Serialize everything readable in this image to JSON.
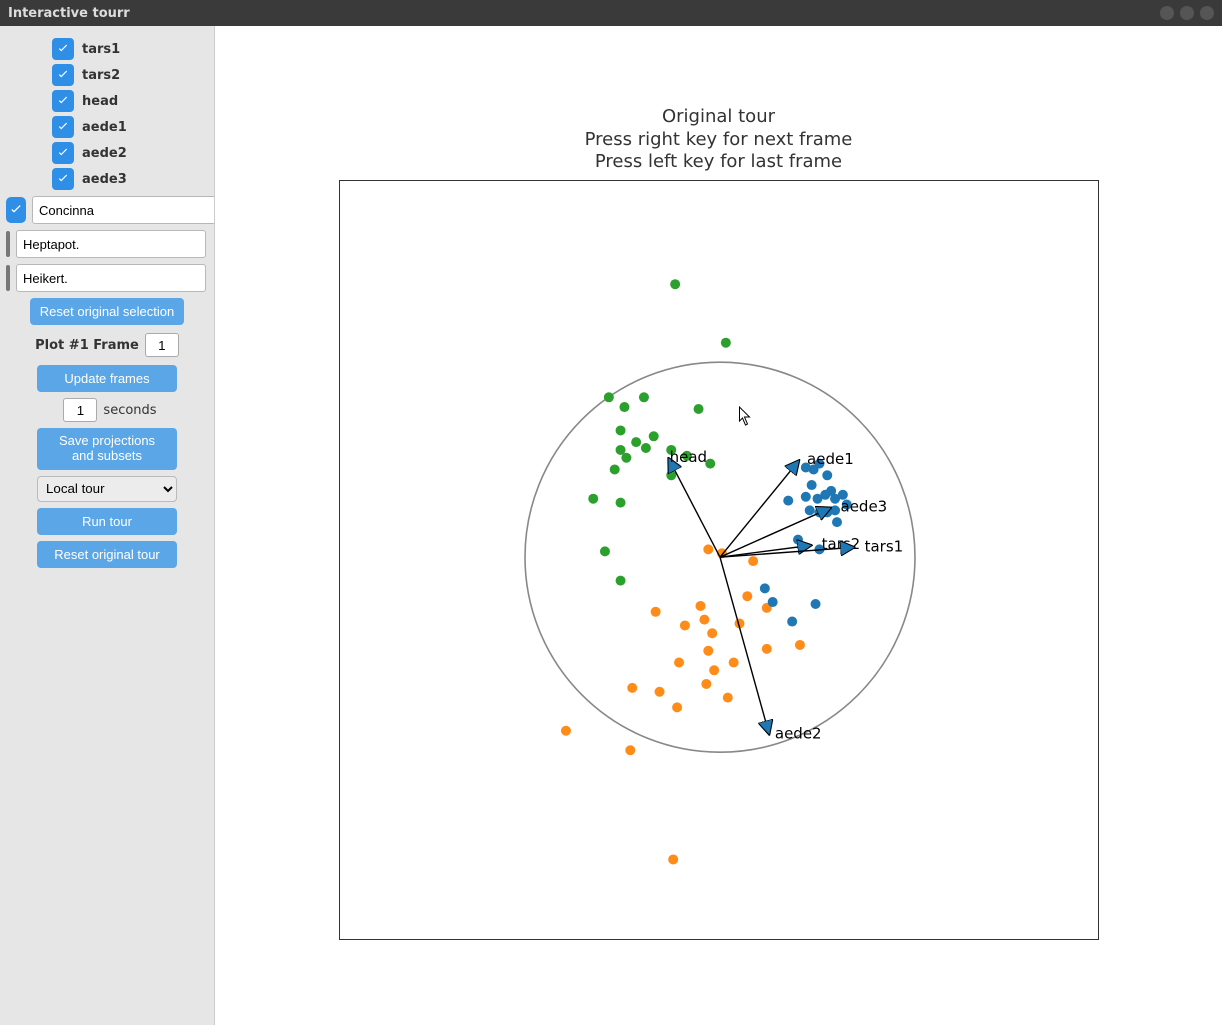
{
  "window": {
    "title": "Interactive tourr"
  },
  "sidebar": {
    "variables": [
      {
        "label": "tars1",
        "checked": true
      },
      {
        "label": "tars2",
        "checked": true
      },
      {
        "label": "head",
        "checked": true
      },
      {
        "label": "aede1",
        "checked": true
      },
      {
        "label": "aede2",
        "checked": true
      },
      {
        "label": "aede3",
        "checked": true
      }
    ],
    "species": [
      {
        "label": "Concinna",
        "checked": true,
        "color": "#1f77b4"
      },
      {
        "label": "Heptapot.",
        "checked": false,
        "color": "#ff8c19"
      },
      {
        "label": "Heikert.",
        "checked": false,
        "color": "#2ca02c"
      }
    ],
    "reset_selection_label": "Reset original selection",
    "frame_label": "Plot #1 Frame",
    "frame_value": "1",
    "update_frames_label": "Update frames",
    "seconds_value": "1",
    "seconds_label": "seconds",
    "seconds_checked": false,
    "save_proj_label": "Save projections\nand subsets",
    "tour_select_value": "Local tour",
    "run_tour_label": "Run tour",
    "reset_tour_label": "Reset original tour"
  },
  "chart_data": {
    "type": "scatter",
    "title": "Original tour\nPress right key for next frame\nPress left key for last frame",
    "xlabel": "",
    "ylabel": "",
    "xlim": [
      -1.0,
      1.0
    ],
    "ylim": [
      -1.0,
      1.0
    ],
    "circle_radius": 1.0,
    "colors": {
      "Concinna": "#1f77b4",
      "Heptapot.": "#ff8c19",
      "Heikert.": "#2ca02c"
    },
    "projection_vectors": [
      {
        "name": "head",
        "x": -0.26,
        "y": 0.5
      },
      {
        "name": "aede1",
        "x": 0.4,
        "y": 0.49
      },
      {
        "name": "aede3",
        "x": 0.56,
        "y": 0.25
      },
      {
        "name": "tars2",
        "x": 0.46,
        "y": 0.06
      },
      {
        "name": "tars1",
        "x": 0.68,
        "y": 0.05
      },
      {
        "name": "aede2",
        "x": 0.25,
        "y": -0.9
      }
    ],
    "series": [
      {
        "name": "Heikert.",
        "points": [
          [
            -0.23,
            1.4
          ],
          [
            0.03,
            1.1
          ],
          [
            -0.49,
            0.77
          ],
          [
            -0.57,
            0.82
          ],
          [
            -0.39,
            0.82
          ],
          [
            -0.11,
            0.76
          ],
          [
            -0.51,
            0.65
          ],
          [
            -0.43,
            0.59
          ],
          [
            -0.38,
            0.56
          ],
          [
            -0.51,
            0.55
          ],
          [
            -0.48,
            0.51
          ],
          [
            -0.25,
            0.55
          ],
          [
            -0.17,
            0.52
          ],
          [
            -0.54,
            0.45
          ],
          [
            -0.25,
            0.42
          ],
          [
            -0.65,
            0.3
          ],
          [
            -0.51,
            0.28
          ],
          [
            -0.59,
            0.03
          ],
          [
            -0.51,
            -0.12
          ],
          [
            -0.05,
            0.48
          ],
          [
            -0.34,
            0.62
          ]
        ]
      },
      {
        "name": "Heptapot.",
        "points": [
          [
            -0.06,
            0.04
          ],
          [
            0.01,
            0.02
          ],
          [
            0.17,
            -0.02
          ],
          [
            -0.1,
            -0.25
          ],
          [
            -0.33,
            -0.28
          ],
          [
            -0.18,
            -0.35
          ],
          [
            -0.08,
            -0.32
          ],
          [
            -0.04,
            -0.39
          ],
          [
            0.1,
            -0.34
          ],
          [
            -0.21,
            -0.54
          ],
          [
            -0.06,
            -0.48
          ],
          [
            0.07,
            -0.54
          ],
          [
            0.24,
            -0.47
          ],
          [
            -0.45,
            -0.67
          ],
          [
            -0.31,
            -0.69
          ],
          [
            -0.22,
            -0.77
          ],
          [
            -0.07,
            -0.65
          ],
          [
            0.04,
            -0.72
          ],
          [
            -0.79,
            -0.89
          ],
          [
            -0.46,
            -0.99
          ],
          [
            -0.24,
            -1.55
          ],
          [
            0.41,
            -0.45
          ],
          [
            0.14,
            -0.2
          ],
          [
            -0.03,
            -0.58
          ],
          [
            0.24,
            -0.26
          ]
        ]
      },
      {
        "name": "Concinna",
        "points": [
          [
            0.44,
            0.46
          ],
          [
            0.48,
            0.45
          ],
          [
            0.51,
            0.48
          ],
          [
            0.57,
            0.34
          ],
          [
            0.55,
            0.42
          ],
          [
            0.35,
            0.29
          ],
          [
            0.44,
            0.31
          ],
          [
            0.5,
            0.3
          ],
          [
            0.54,
            0.32
          ],
          [
            0.59,
            0.3
          ],
          [
            0.63,
            0.32
          ],
          [
            0.46,
            0.24
          ],
          [
            0.51,
            0.23
          ],
          [
            0.55,
            0.23
          ],
          [
            0.59,
            0.24
          ],
          [
            0.65,
            0.27
          ],
          [
            0.4,
            0.09
          ],
          [
            0.51,
            0.04
          ],
          [
            0.23,
            -0.16
          ],
          [
            0.27,
            -0.23
          ],
          [
            0.37,
            -0.33
          ],
          [
            0.49,
            -0.24
          ],
          [
            0.47,
            0.37
          ],
          [
            0.6,
            0.18
          ]
        ]
      }
    ],
    "cursor": {
      "x": 0.1,
      "y": 0.77
    }
  }
}
